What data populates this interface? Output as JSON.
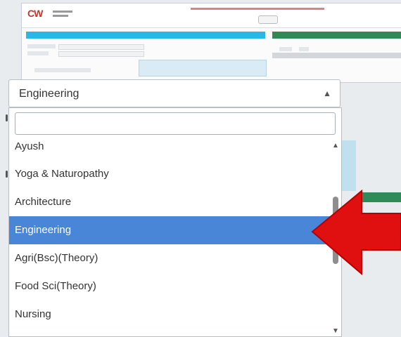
{
  "select": {
    "value": "Engineering",
    "search_value": ""
  },
  "options": [
    {
      "label": "Ayush",
      "highlighted": false
    },
    {
      "label": "Yoga & Naturopathy",
      "highlighted": false
    },
    {
      "label": "Architecture",
      "highlighted": false
    },
    {
      "label": "Engineering",
      "highlighted": true
    },
    {
      "label": "Agri(Bsc)(Theory)",
      "highlighted": false
    },
    {
      "label": "Food Sci(Theory)",
      "highlighted": false
    },
    {
      "label": "Nursing",
      "highlighted": false
    }
  ],
  "colors": {
    "highlight": "#4a86d8",
    "annotation_arrow": "#e01010",
    "bar_blue": "#29b6e8",
    "bar_green": "#2e8b57"
  },
  "icons": {
    "select_arrow": "chevron-up-icon",
    "scroll_up": "triangle-up-icon",
    "scroll_down": "triangle-down-icon",
    "annotation": "red-arrow-left-icon"
  }
}
